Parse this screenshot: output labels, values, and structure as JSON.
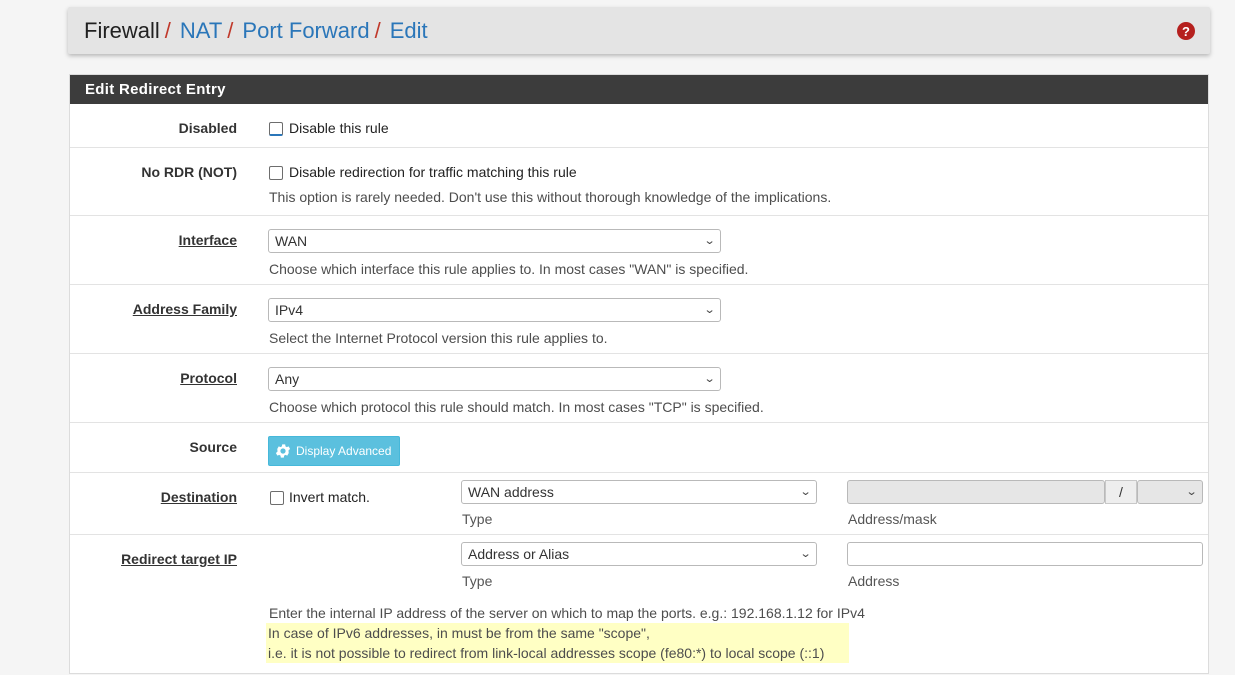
{
  "breadcrumb": {
    "firewall": "Firewall",
    "nat": "NAT",
    "port_forward": "Port Forward",
    "edit": "Edit",
    "separator": "/"
  },
  "help_icon": {
    "glyph": "?",
    "color": "#b5201e"
  },
  "panel": {
    "title": "Edit Redirect Entry"
  },
  "disabled": {
    "label": "Disabled",
    "checkbox_label": "Disable this rule",
    "checked": false
  },
  "no_rdr": {
    "label": "No RDR (NOT)",
    "checkbox_label": "Disable redirection for traffic matching this rule",
    "help": "This option is rarely needed. Don't use this without thorough knowledge of the implications.",
    "checked": false
  },
  "interface": {
    "label": "Interface",
    "value": "WAN",
    "help": "Choose which interface this rule applies to. In most cases \"WAN\" is specified."
  },
  "address_family": {
    "label": "Address Family",
    "value": "IPv4",
    "help": "Select the Internet Protocol version this rule applies to."
  },
  "protocol": {
    "label": "Protocol",
    "value": "Any",
    "help": "Choose which protocol this rule should match. In most cases \"TCP\" is specified."
  },
  "source": {
    "label": "Source",
    "button_label": "Display Advanced",
    "button_icon": "gear-icon",
    "button_color": "#5bc0de"
  },
  "destination": {
    "label": "Destination",
    "invert_label": "Invert match.",
    "invert_checked": false,
    "type_value": "WAN address",
    "type_label": "Type",
    "address_value": "",
    "mask_separator": "/",
    "mask_value": "",
    "address_label": "Address/mask"
  },
  "redirect_target": {
    "label": "Redirect target IP",
    "type_value": "Address or Alias",
    "type_label": "Type",
    "address_value": "",
    "address_label": "Address",
    "help_line1": "Enter the internal IP address of the server on which to map the ports. e.g.: 192.168.1.12 for IPv4",
    "help_line2": "In case of IPv6 addresses, in must be from the same \"scope\",",
    "help_line3": "i.e. it is not possible to redirect from link-local addresses scope (fe80:*) to local scope (::1)",
    "highlight_color": "#ffffc4"
  },
  "chevron": "⌄"
}
